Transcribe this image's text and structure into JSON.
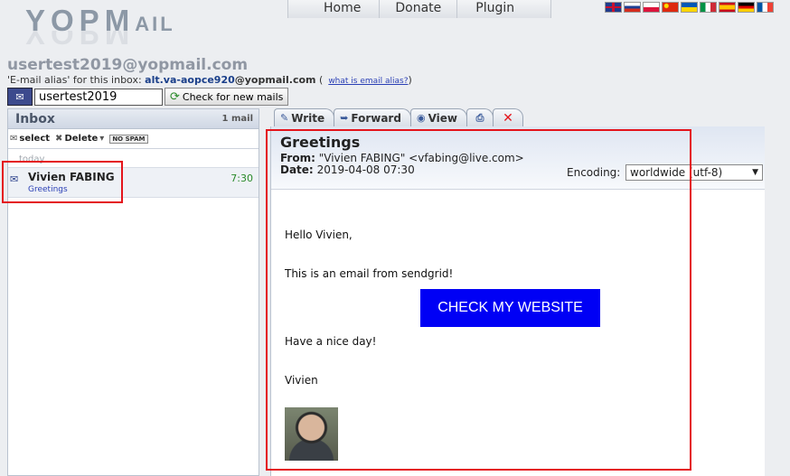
{
  "header": {
    "logo_main": "YOPM",
    "logo_tail": "AIL",
    "nav": [
      "Home",
      "Donate",
      "Plugin"
    ],
    "flags": [
      {
        "name": "uk-flag",
        "color": "#1f3b8c"
      },
      {
        "name": "russia-flag",
        "color": "#d52b1e"
      },
      {
        "name": "poland-flag",
        "color": "#dc143c"
      },
      {
        "name": "china-flag",
        "color": "#de2910"
      },
      {
        "name": "ukraine-flag",
        "color": "#ffd500"
      },
      {
        "name": "italy-flag",
        "color": "#009246"
      },
      {
        "name": "spain-flag",
        "color": "#c60b1e"
      },
      {
        "name": "germany-flag",
        "color": "#000000"
      },
      {
        "name": "france-flag",
        "color": "#0055a4"
      }
    ]
  },
  "account": {
    "address": "usertest2019@yopmail.com",
    "alias_prefix": "'E-mail alias' for this inbox:",
    "alias_value": "alt.va-aopce920",
    "alias_domain": "@yopmail.com",
    "alias_help": "what is email alias?",
    "login_value": "usertest2019",
    "check_button": "Check for new mails"
  },
  "inbox": {
    "title": "Inbox",
    "count": "1 mail",
    "tools": {
      "select": "select",
      "delete": "Delete",
      "nospam": "NO SPAM"
    },
    "group_label": "today",
    "items": [
      {
        "from": "Vivien FABING",
        "subject": "Greetings",
        "time": "7:30"
      }
    ]
  },
  "tabs": {
    "write": "Write",
    "forward": "Forward",
    "view": "View"
  },
  "message": {
    "subject": "Greetings",
    "from_label": "From:",
    "from_value": "\"Vivien FABING\" <vfabing@live.com>",
    "date_label": "Date:",
    "date_value": "2019-04-08 07:30",
    "encoding_label": "Encoding:",
    "encoding_value": "worldwide (utf-8)",
    "body": {
      "greeting": "Hello Vivien,",
      "line1": "This is an email from sendgrid!",
      "cta": "CHECK MY WEBSITE",
      "line2": "Have a nice day!",
      "signature": "Vivien"
    }
  },
  "colors": {
    "highlight": "#e4141b",
    "cta": "#0000f5",
    "time": "#2a8a2a"
  }
}
